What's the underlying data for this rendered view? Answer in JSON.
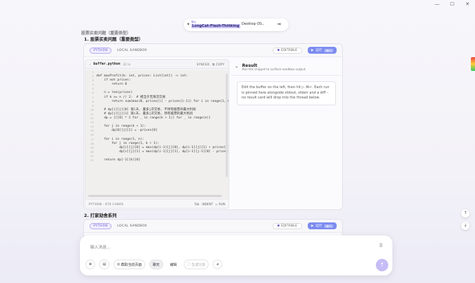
{
  "window": {
    "minimize": "—",
    "maximize": "☐",
    "close": "✕"
  },
  "top_bar": {
    "badge": "默认",
    "model": "LongCat-Flash-Thinking",
    "mode": "Desktop OS"
  },
  "cut_line": "股票买卖问题（重要类型）",
  "sections": [
    {
      "title": "1. 股票买卖问题（重要类型）"
    },
    {
      "title": "2. 打家劫舍系列"
    }
  ],
  "card": {
    "lang": "PYTHON",
    "sandbox": "LOCAL SANDBOX",
    "editable": "EDITABLE",
    "run": "运行",
    "run_kbd": "⌘↵"
  },
  "editor": {
    "file": "buffer.python",
    "lines_label": "22 ln",
    "synced": "SYNCED",
    "copy": "COPY",
    "footer_info": "PYTHON · 670 CHARS",
    "tab": "Tab",
    "indent": "INDENT",
    "run": "RUN",
    "code": [
      "",
      "def maxProfit(k: int, prices: List[int]) -> int:",
      "    if not prices:",
      "        return 0",
      "",
      "    n = len(prices)",
      "    if k >= n // 2:  # 相当于无限次交易",
      "        return sum(max(0, prices[i] - prices[i-1]) for i in range(1, n))",
      "",
      "    # dp[i][j][0] 第i天, 最多j次交易, 不持有股票的最大利润",
      "    # dp[i][j][1] 第i天, 最多j次交易, 持有股票的最大利润",
      "    dp = [[[0] * 2 for _ in range(k + 1)] for _ in range(n)]",
      "",
      "    for j in range(k + 1):",
      "        dp[0][j][1] = -prices[0]",
      "",
      "    for i in range(1, n):",
      "        for j in range(1, k + 1):",
      "            dp[i][j][0] = max(dp[i-1][j][0], dp[i-1][j][1] + prices[i])",
      "            dp[i][j][1] = max(dp[i-1][j][1], dp[i-1][j-1][0] - prices[i])",
      "",
      "    return dp[-1][k][0]"
    ]
  },
  "result": {
    "title": "Result",
    "subtitle": "Run the snippet to surface sandbox output.",
    "message": "Edit the buffer on the left, then hit ▷ ⌘↵. Each run is pinned here alongside stdout, stderr and a diff – no result card will drop into the thread below."
  },
  "scroll": {
    "up": "↑",
    "down": "↓"
  },
  "chat": {
    "placeholder": "输入消息...",
    "tools": [
      "截取当前页面",
      "聊天",
      "编辑",
      "生成分割"
    ]
  }
}
